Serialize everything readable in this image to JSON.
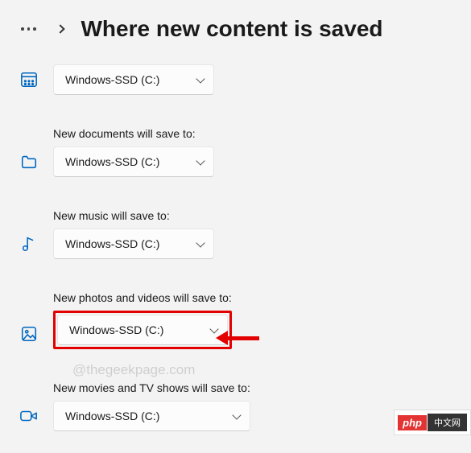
{
  "header": {
    "title": "Where new content is saved"
  },
  "sections": {
    "apps": {
      "value": "Windows-SSD (C:)"
    },
    "documents": {
      "label": "New documents will save to:",
      "value": "Windows-SSD (C:)"
    },
    "music": {
      "label": "New music will save to:",
      "value": "Windows-SSD (C:)"
    },
    "photos": {
      "label": "New photos and videos will save to:",
      "value": "Windows-SSD (C:)"
    },
    "movies": {
      "label": "New movies and TV shows will save to:",
      "value": "Windows-SSD (C:)"
    }
  },
  "watermark": "@thegeekpage.com",
  "badge": {
    "left": "php",
    "right": "中文网"
  }
}
